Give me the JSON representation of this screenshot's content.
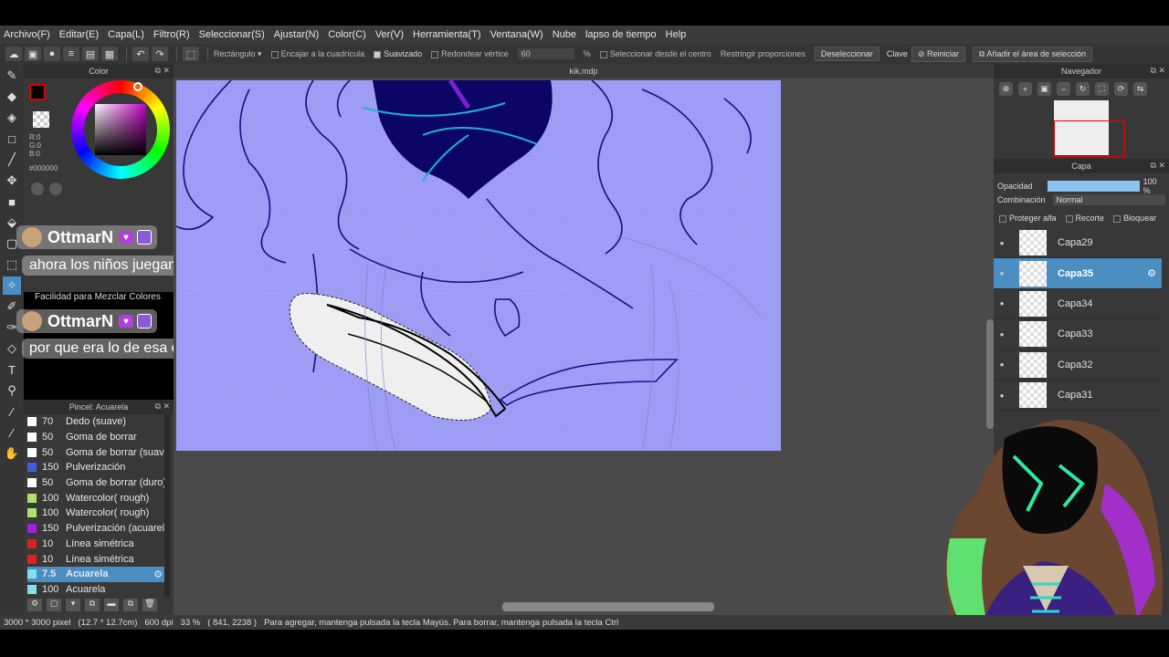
{
  "menu": [
    "Archivo(F)",
    "Editar(E)",
    "Capa(L)",
    "Filtro(R)",
    "Seleccionar(S)",
    "Ajustar(N)",
    "Color(C)",
    "Ver(V)",
    "Herramienta(T)",
    "Ventana(W)",
    "Nube",
    "lapso de tiempo",
    "Help"
  ],
  "toolbar": {
    "shape": "Rectángulo",
    "snap_grid": "Encajar a la cuadrícula",
    "smooth": "Suavizado",
    "round_corner": "Redondear vértice",
    "round_value": "60",
    "percent": "%",
    "from_center": "Seleccionar desde el centro",
    "restrict": "Restringir proporciones",
    "deselect": "Deseleccionar",
    "key": "Clave",
    "reset": "Reiniciar",
    "add_selection": "Añadir el área de selección"
  },
  "color_panel": {
    "title": "Color",
    "rgb": "R:0\nG:0\nB:0",
    "hex": "#000000",
    "mix_label": "Facilidad para Mezclar Colores"
  },
  "chat": [
    {
      "user": "OttmarN",
      "message": "ahora los niños juegan roblox"
    },
    {
      "user": "OttmarN",
      "message": "por que era lo de esa epoca"
    }
  ],
  "brush_panel": {
    "title": "Pincel: Acuarela",
    "brushes": [
      {
        "size": "70",
        "name": "Dedo (suave)",
        "color": "#ffffff"
      },
      {
        "size": "50",
        "name": "Goma de borrar",
        "color": "#ffffff"
      },
      {
        "size": "50",
        "name": "Goma de borrar (suave)",
        "color": "#ffffff"
      },
      {
        "size": "150",
        "name": "Pulverización",
        "color": "#4060e0"
      },
      {
        "size": "50",
        "name": "Goma de borrar (duro)",
        "color": "#ffffff"
      },
      {
        "size": "100",
        "name": "Watercolor( rough)",
        "color": "#b0e070"
      },
      {
        "size": "100",
        "name": "Watercolor( rough)",
        "color": "#b0e070"
      },
      {
        "size": "150",
        "name": "Pulverización (acuarela)",
        "color": "#a020e0"
      },
      {
        "size": "10",
        "name": "Línea simétrica",
        "color": "#e02020"
      },
      {
        "size": "10",
        "name": "Línea simétrica",
        "color": "#e02020"
      },
      {
        "size": "7.5",
        "name": "Acuarela",
        "color": "#80e0f0"
      },
      {
        "size": "100",
        "name": "Acuarela",
        "color": "#80e0f0"
      }
    ]
  },
  "canvas": {
    "doc_name": "kik.mdp"
  },
  "navigator": {
    "title": "Navegador"
  },
  "layers_panel": {
    "title": "Capa",
    "opacity_label": "Opacidad",
    "opacity_value": "100 %",
    "opacity_level": 1.0,
    "blend_label": "Combinación",
    "blend_value": "Normal",
    "protect_alpha": "Proteger alfa",
    "clip": "Recorte",
    "lock": "Bloquear",
    "layers": [
      "Capa29",
      "Capa35",
      "Capa34",
      "Capa33",
      "Capa32",
      "Capa31"
    ]
  },
  "status": {
    "size": "3000 * 3000 pixel",
    "cm": "(12.7 * 12.7cm)",
    "dpi": "600 dpi",
    "zoom": "33 %",
    "coords": "( 841, 2238 )",
    "hint": "Para agregar, mantenga pulsada la tecla Mayús. Para borrar, mantenga pulsada la tecla Ctrl"
  }
}
